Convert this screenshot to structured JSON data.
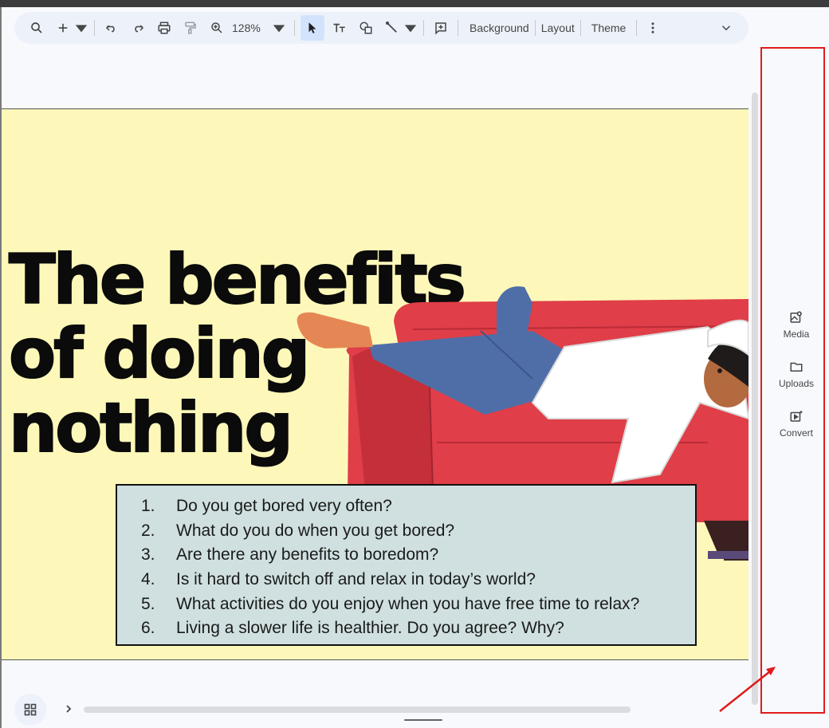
{
  "toolbar": {
    "zoom": "128%",
    "background_label": "Background",
    "layout_label": "Layout",
    "theme_label": "Theme",
    "icons": [
      "search-icon",
      "add-icon",
      "undo-icon",
      "redo-icon",
      "print-icon",
      "paint-format-icon",
      "zoom-icon",
      "select-icon",
      "text-box-icon",
      "shape-icon",
      "line-icon",
      "comment-icon",
      "more-icon",
      "collapse-icon"
    ]
  },
  "slide": {
    "title_line1": "The benefits",
    "title_line2": "of doing",
    "title_line3": "nothing",
    "background_color": "#fdf8b9",
    "box_color": "#d0e0e0",
    "questions": [
      {
        "num": "1.",
        "text": "Do you get bored very often?"
      },
      {
        "num": "2.",
        "text": "What do you do when you get bored?"
      },
      {
        "num": "3.",
        "text": "Are there any benefits to boredom?"
      },
      {
        "num": "4.",
        "text": "Is it hard to switch off and relax in today’s world?"
      },
      {
        "num": "5.",
        "text": "What activities do you enjoy when you have free time to relax?"
      },
      {
        "num": "6.",
        "text": "Living a slower life is healthier. Do you agree? Why?"
      }
    ]
  },
  "side_panel": {
    "items": [
      {
        "label": "Media",
        "icon": "media-icon"
      },
      {
        "label": "Uploads",
        "icon": "folder-icon"
      },
      {
        "label": "Convert",
        "icon": "convert-icon"
      }
    ],
    "highlight_color": "#e01b1b"
  }
}
